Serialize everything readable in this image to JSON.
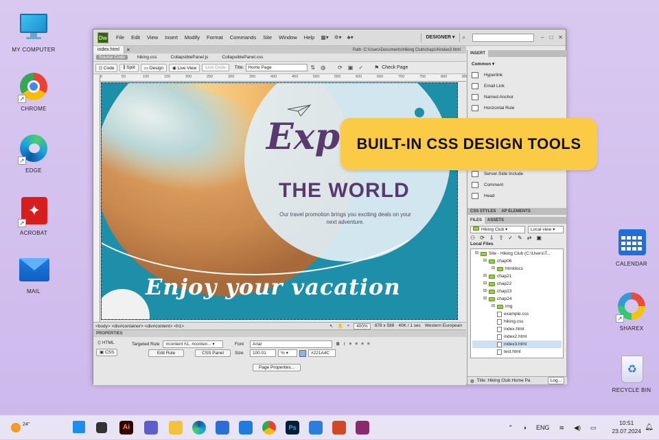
{
  "desktop": {
    "left_icons": [
      {
        "label": "MY COMPUTER"
      },
      {
        "label": "CHROME"
      },
      {
        "label": "EDGE"
      },
      {
        "label": "ACROBAT"
      },
      {
        "label": "MAIL"
      }
    ],
    "right_icons": [
      {
        "label": "CALENDAR"
      },
      {
        "label": "SHAREX"
      },
      {
        "label": "RECYCLE BIN"
      }
    ]
  },
  "app": {
    "logo": "Dw",
    "menu": [
      "File",
      "Edit",
      "View",
      "Insert",
      "Modify",
      "Format",
      "Commands",
      "Site",
      "Window",
      "Help"
    ],
    "workspace": "DESIGNER",
    "doc_tab": "index.html",
    "path": "Path:  C:\\Users\\Documents\\Hiking Club\\chap14\\index3.html",
    "source_code": "Source Code",
    "related_files": [
      "hiking.css",
      "CollapsiblePanel.js",
      "CollapsiblePanel.css"
    ],
    "toolbar": {
      "code": "Code",
      "split": "Split",
      "design": "Design",
      "live_view": "Live View",
      "live_code": "Live Code",
      "title_label": "Title:",
      "title_value": "Home Page",
      "check_page": "Check Page"
    },
    "ruler": [
      "0",
      "50",
      "100",
      "150",
      "200",
      "250",
      "300",
      "350",
      "400",
      "450",
      "500",
      "550",
      "600",
      "650",
      "700",
      "750",
      "800",
      "850"
    ]
  },
  "canvas": {
    "headline_script": "Explore",
    "headline": "THE WORLD",
    "tagline": "Our travel promotion brings you exciting deals on your next adventure.",
    "footer_script": "Enjoy your vacation"
  },
  "status_bar": {
    "tags": "<body> <div#container> <div#content> <h1>",
    "zoom": "400%",
    "dimensions": "878 x 588",
    "size": "40K / 1 sec",
    "encoding": "Western European"
  },
  "properties": {
    "header": "PROPERTIES",
    "html_btn": "HTML",
    "css_btn": "CSS",
    "targeted_rule_label": "Targeted Rule",
    "targeted_rule_value": "#content h1, #conten...",
    "edit_rule": "Edit Rule",
    "css_panel": "CSS Panel",
    "font_label": "Font",
    "font_value": "Arial",
    "size_label": "Size",
    "size_value": "100.01",
    "size_unit": "%",
    "color_value": "#221A4C",
    "page_properties": "Page Properties..."
  },
  "insert_panel": {
    "tab": "INSERT",
    "category": "Common",
    "items": [
      "Hyperlink",
      "Email Link",
      "Named Anchor",
      "Horizontal Rule",
      "Server-Side Include",
      "Comment",
      "Head"
    ]
  },
  "files_panel": {
    "tabs_top": [
      "CSS STYLES",
      "AP ELEMENTS"
    ],
    "tabs": [
      "FILES",
      "ASSETS"
    ],
    "site": "Hiking Club",
    "view": "Local view",
    "local_files": "Local Files",
    "tree": [
      {
        "name": "Site - Hiking Club (C:\\Users\\T...",
        "type": "folder",
        "indent": 0
      },
      {
        "name": "chap06",
        "type": "folder",
        "indent": 1
      },
      {
        "name": "htmldocs",
        "type": "folder",
        "indent": 2
      },
      {
        "name": "chap21",
        "type": "folder",
        "indent": 1
      },
      {
        "name": "chap22",
        "type": "folder",
        "indent": 1
      },
      {
        "name": "chap23",
        "type": "folder",
        "indent": 1
      },
      {
        "name": "chap24",
        "type": "folder",
        "indent": 1
      },
      {
        "name": "img",
        "type": "folder",
        "indent": 2
      },
      {
        "name": "example.css",
        "type": "file",
        "indent": 2
      },
      {
        "name": "hiking.css",
        "type": "file",
        "indent": 2
      },
      {
        "name": "index.html",
        "type": "file",
        "indent": 2
      },
      {
        "name": "index2.html",
        "type": "file",
        "indent": 2
      },
      {
        "name": "index3.html",
        "type": "file",
        "indent": 2,
        "selected": true
      },
      {
        "name": "test.html",
        "type": "file",
        "indent": 2
      }
    ],
    "status_title": "Title: Hiking Club Home Pa",
    "log_btn": "Log..."
  },
  "callout": "BUILT-IN CSS DESIGN TOOLS",
  "taskbar": {
    "weather": "24°",
    "lang": "ENG",
    "time": "10:51",
    "date": "23.07.2024"
  },
  "colors": {
    "accent": "#fccb45",
    "teal": "#1e8fa8",
    "purple": "#5a3a6e"
  }
}
